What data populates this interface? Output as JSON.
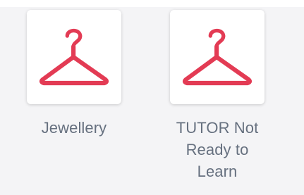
{
  "items": [
    {
      "label": "Jewellery",
      "icon": "hanger-question-icon",
      "icon_color": "#e33b54"
    },
    {
      "label": "TUTOR Not Ready to Learn",
      "icon": "hanger-question-icon",
      "icon_color": "#e33b54"
    }
  ]
}
